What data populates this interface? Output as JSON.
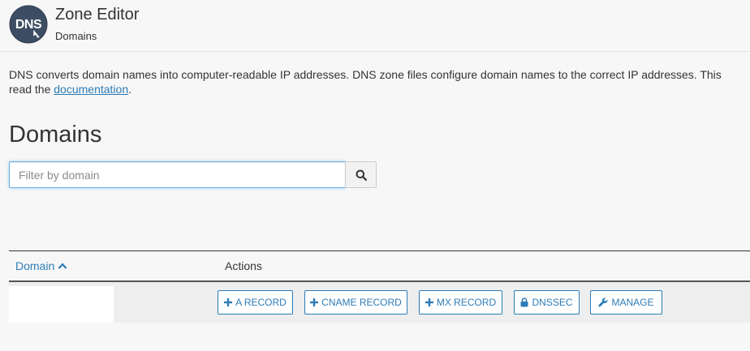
{
  "header": {
    "logo_text": "DNS",
    "title": "Zone Editor",
    "subtitle": "Domains"
  },
  "description": {
    "text_line1": "DNS converts domain names into computer-readable IP addresses. DNS zone files configure domain names to the correct IP addresses. This",
    "text_line2_prefix": "read the ",
    "link_text": "documentation",
    "text_line2_suffix": "."
  },
  "page_title": "Domains",
  "search": {
    "placeholder": "Filter by domain",
    "value": ""
  },
  "table": {
    "columns": {
      "domain": "Domain",
      "actions": "Actions"
    },
    "rows": [
      {
        "domain": "",
        "actions": {
          "a_record": "A Record",
          "cname_record": "CNAME Record",
          "mx_record": "MX Record",
          "dnssec": "DNSSEC",
          "manage": "Manage"
        }
      }
    ]
  },
  "colors": {
    "link": "#2c7cb7",
    "logo_bg": "#3d4d63",
    "focus_border": "#66afe9"
  }
}
